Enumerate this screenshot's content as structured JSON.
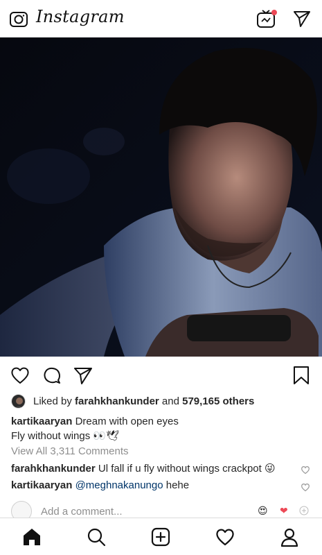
{
  "app": {
    "logo_text": "Instagram",
    "camera_icon": "camera-icon",
    "igtv_icon": "igtv-icon",
    "direct_icon": "paper-plane-icon",
    "notification_dot_color": "#ed4956"
  },
  "post": {
    "actions": [
      "heart-icon",
      "comment-icon",
      "share-icon",
      "bookmark-icon"
    ],
    "liked_by_prefix": "Liked by",
    "liked_by_user": "farahkhankunder",
    "liked_by_and": "and",
    "likes_count": "579,165 others",
    "caption_user": "kartikaaryan",
    "caption_line1": "Dream with open eyes",
    "caption_line2": "Fly without wings",
    "caption_emoji": "👀🕊",
    "view_all": "View All 3,311 Comments",
    "comments": [
      {
        "user": "farahkhankunder",
        "text": "Ul fall if u fly without wings crackpot",
        "emoji": "😜"
      },
      {
        "user": "kartikaaryan",
        "mention": "@meghnakanungo",
        "text": "hehe"
      }
    ],
    "add_comment_placeholder": "Add a comment...",
    "quick_emoji_1": "😍",
    "quick_emoji_2": "❤",
    "mention_color": "#003569"
  },
  "tabbar": {
    "tabs": [
      "home-icon",
      "search-icon",
      "new-post-icon",
      "activity-icon",
      "profile-icon"
    ]
  }
}
